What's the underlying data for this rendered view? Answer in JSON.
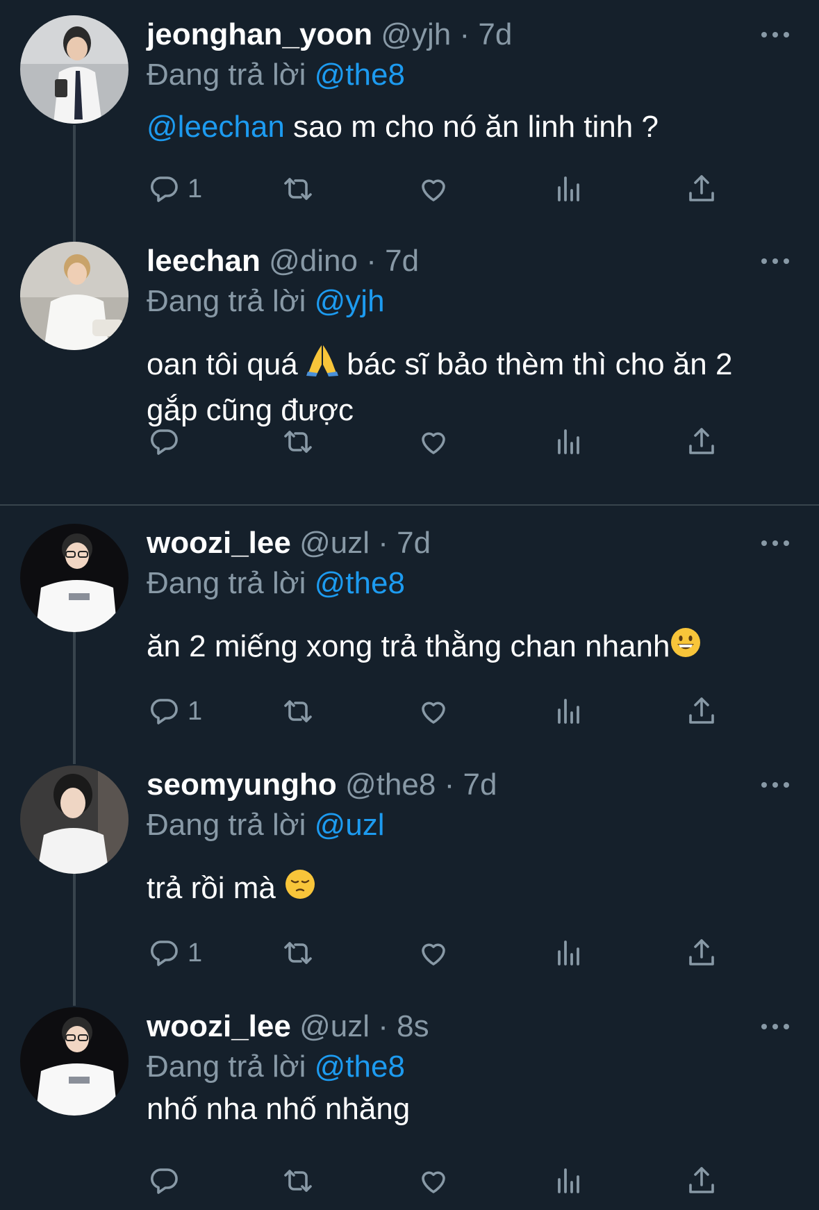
{
  "tweets": [
    {
      "display_name": "jeonghan_yoon",
      "handle": "@yjh",
      "time": "7d",
      "reply_prefix": "Đang trả lời",
      "reply_to": "@the8",
      "text_mention": "@leechan",
      "text": " sao m cho nó ăn linh tinh ?",
      "reply_count": "1"
    },
    {
      "display_name": "leechan",
      "handle": "@dino",
      "time": "7d",
      "reply_prefix": "Đang trả lời",
      "reply_to": "@yjh",
      "text_a": "oan tôi quá ",
      "text_b": " bác sĩ bảo thèm thì cho ăn 2 gắp cũng được",
      "reply_count": ""
    },
    {
      "display_name": "woozi_lee",
      "handle": "@uzl",
      "time": "7d",
      "reply_prefix": "Đang trả lời",
      "reply_to": "@the8",
      "text": "ăn 2 miếng xong trả thằng chan nhanh",
      "reply_count": "1"
    },
    {
      "display_name": "seomyungho",
      "handle": "@the8",
      "time": "7d",
      "reply_prefix": "Đang trả lời",
      "reply_to": "@uzl",
      "text": "trả rồi mà ",
      "reply_count": "1"
    },
    {
      "display_name": "woozi_lee",
      "handle": "@uzl",
      "time": "8s",
      "reply_prefix": "Đang trả lời",
      "reply_to": "@the8",
      "text": "nhố nha nhố nhăng",
      "reply_count": ""
    }
  ],
  "separator": "·",
  "icons": [
    "reply-icon",
    "retweet-icon",
    "like-icon",
    "views-icon",
    "share-icon",
    "more-icon"
  ],
  "colors": {
    "background": "#15202b",
    "muted": "#8899a6",
    "accent": "#1d9bf0",
    "line": "#38444d"
  }
}
